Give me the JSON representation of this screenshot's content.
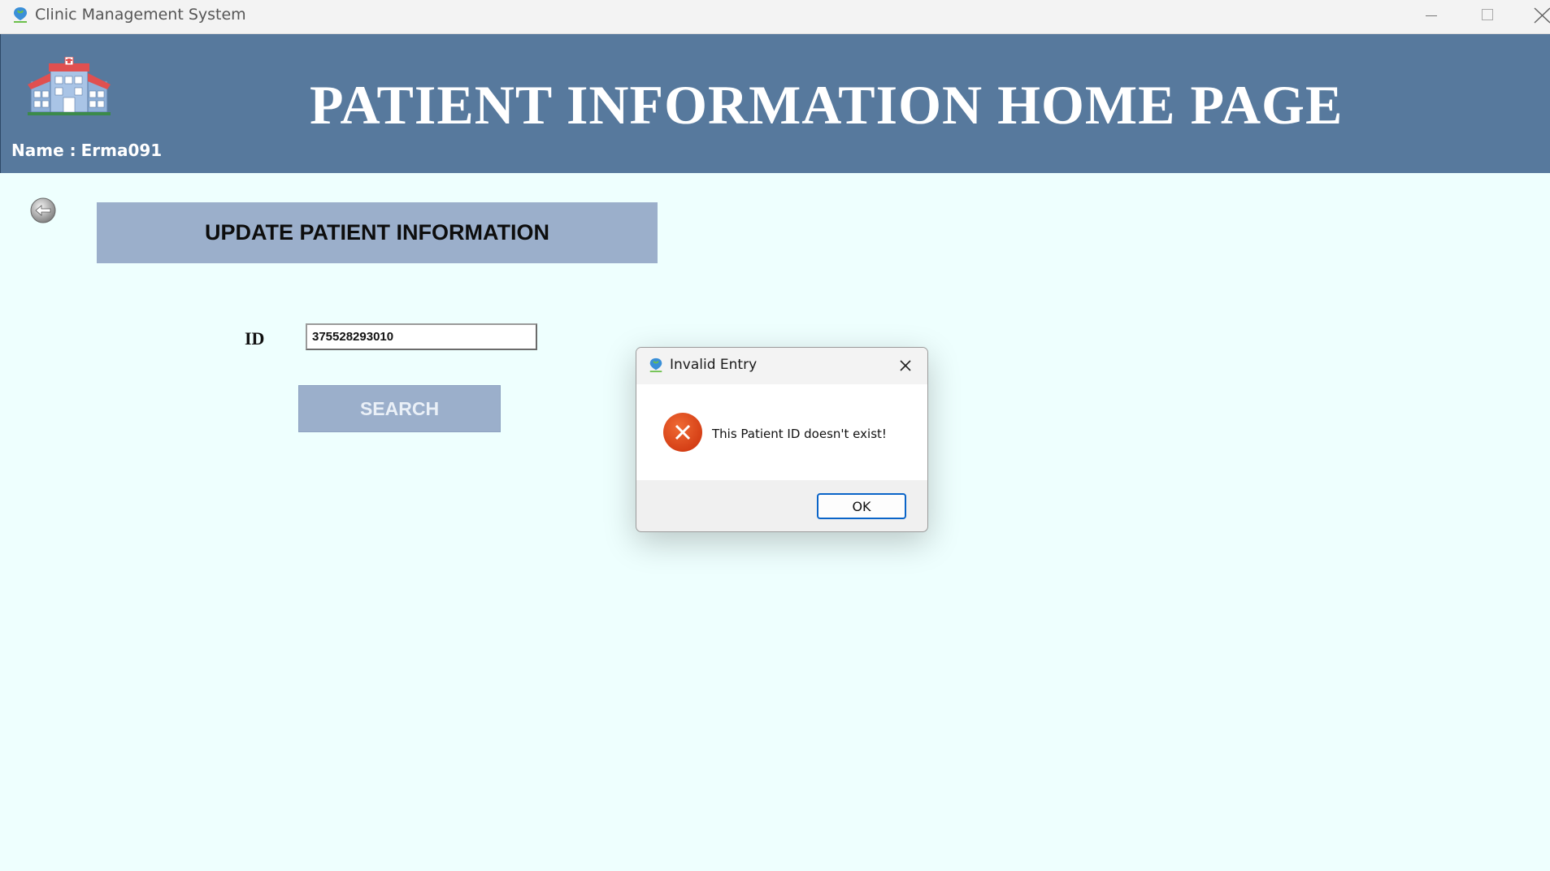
{
  "window": {
    "title": "Clinic Management System"
  },
  "header": {
    "title": "PATIENT INFORMATION HOME PAGE",
    "user_label": "Name :",
    "user_name": "Erma091"
  },
  "main": {
    "section_title": "UPDATE PATIENT  INFORMATION",
    "id_label": "ID",
    "id_value": "375528293010",
    "search_label": "SEARCH"
  },
  "dialog": {
    "title": "Invalid Entry",
    "message": "This Patient ID doesn't exist!",
    "ok_label": "OK",
    "icon": "error-icon"
  },
  "colors": {
    "header_bg": "#57799d",
    "banner_bg": "#9bafcb",
    "page_bg": "#eefffe",
    "error_red": "#e0461c",
    "ok_border": "#0a64c8"
  }
}
